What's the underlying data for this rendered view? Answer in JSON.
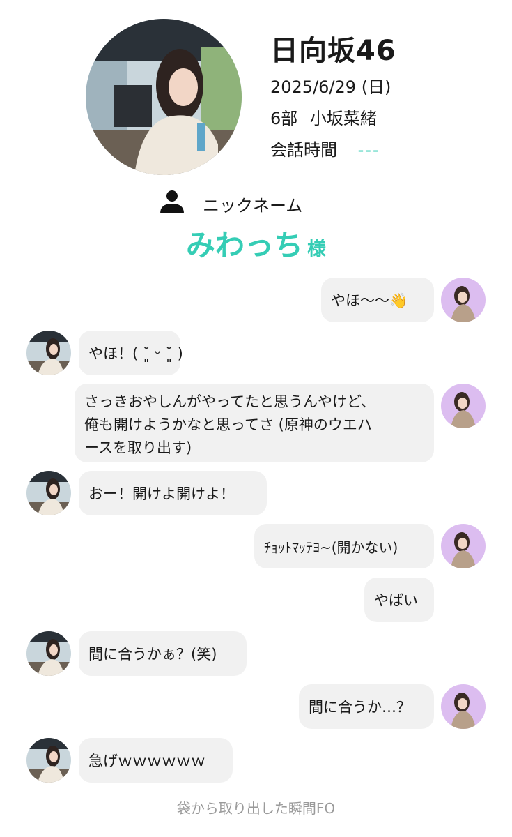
{
  "header": {
    "group": "日向坂46",
    "date": "2025/6/29 (日)",
    "session": "6部",
    "member": "小坂菜緒",
    "talk_time_label": "会話時間",
    "talk_time_value": "---"
  },
  "nickname": {
    "label": "ニックネーム",
    "value": "みわっち",
    "honorific": "様"
  },
  "colors": {
    "accent": "#35cdb5",
    "bubble": "#f1f1f1",
    "fan_avatar_bg": "#dcbdf0"
  },
  "messages": [
    {
      "from": "fan",
      "text": "やほ〜〜👋"
    },
    {
      "from": "member",
      "text": "やほ！( ˘͈ ᵕ ˘͈ )"
    },
    {
      "from": "fan",
      "lines": [
        "さっきおやしんがやってたと思うんやけど、",
        "俺も開けようかなと思ってさ (原神のウエハ",
        "ースを取り出す)"
      ]
    },
    {
      "from": "member",
      "text": "おー！開けよ開けよ！"
    },
    {
      "from": "fan",
      "text": "ﾁｮｯﾄﾏｯﾃﾖ~(開かない)"
    },
    {
      "from": "fan",
      "text": "やばい"
    },
    {
      "from": "member",
      "text": "間に合うかぁ？(笑)"
    },
    {
      "from": "fan",
      "text": "間に合うか…？"
    },
    {
      "from": "member",
      "text": "急げｗｗｗｗｗｗ"
    }
  ],
  "footer": "袋から取り出した瞬間FO"
}
